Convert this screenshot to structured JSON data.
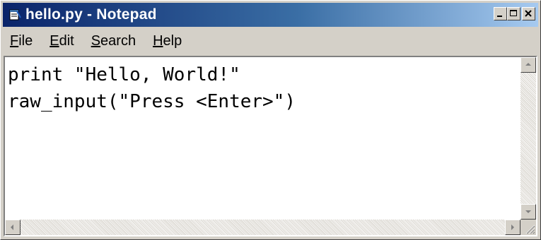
{
  "window": {
    "title": "hello.py - Notepad",
    "icon": "notepad-icon"
  },
  "title_buttons": {
    "minimize_icon": "minimize-icon",
    "maximize_icon": "maximize-icon",
    "close_icon": "close-icon"
  },
  "menu": {
    "items": [
      {
        "label": "File",
        "mnemonic": "F",
        "rest": "ile"
      },
      {
        "label": "Edit",
        "mnemonic": "E",
        "rest": "dit"
      },
      {
        "label": "Search",
        "mnemonic": "S",
        "rest": "earch"
      },
      {
        "label": "Help",
        "mnemonic": "H",
        "rest": "elp"
      }
    ]
  },
  "editor": {
    "lines": [
      "print \"Hello, World!\"",
      "raw_input(\"Press <Enter>\")"
    ]
  },
  "colors": {
    "titlebar_start": "#0a246a",
    "titlebar_end": "#a6caf0",
    "face": "#d4d0c8"
  }
}
